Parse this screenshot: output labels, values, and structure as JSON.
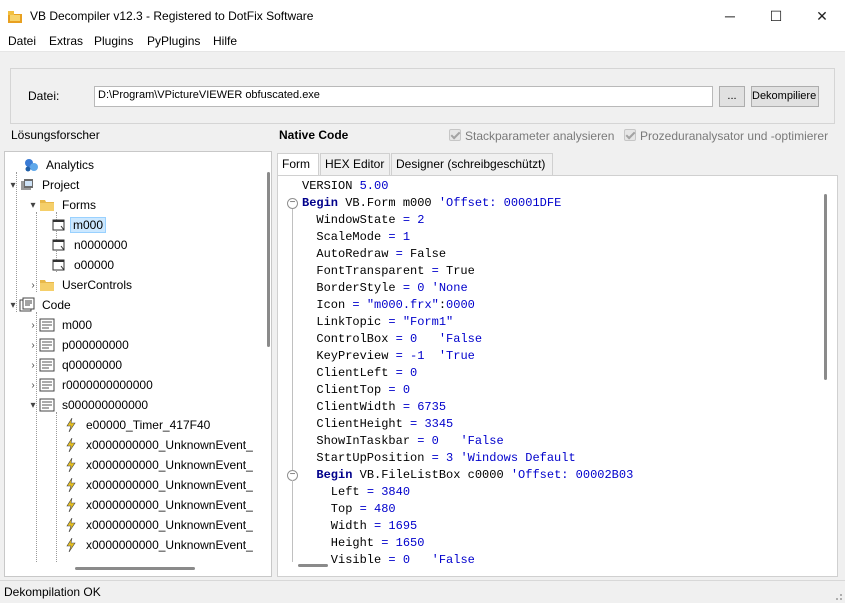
{
  "window": {
    "title": "VB Decompiler v12.3 - Registered to DotFix Software",
    "minimize_glyph": "─",
    "maximize_glyph": "☐",
    "close_glyph": "✕"
  },
  "menu": [
    "Datei",
    "Extras",
    "Plugins",
    "PyPlugins",
    "Hilfe"
  ],
  "file_panel": {
    "label": "Datei:",
    "path": "D:\\Program\\VPictureVIEWER obfuscated.exe",
    "browse_label": "...",
    "decompile_label": "Dekompiliere"
  },
  "headings": {
    "solution_explorer": "Lösungsforscher",
    "native_code": "Native Code"
  },
  "options": {
    "stack_params": {
      "label": "Stackparameter analysieren",
      "checked": true,
      "enabled": false
    },
    "proc_analyzer": {
      "label": "Prozeduranalysator und -optimierer",
      "checked": true,
      "enabled": false
    }
  },
  "tree": [
    {
      "label": "Analytics",
      "icon": "analytics-icon",
      "expander": "",
      "selected": false
    },
    {
      "label": "Project",
      "icon": "project-icon",
      "expander": "▾",
      "selected": false
    },
    {
      "label": "Forms",
      "icon": "folder-open-icon",
      "expander": "▾",
      "selected": false
    },
    {
      "label": "m000",
      "icon": "form-icon",
      "expander": "",
      "selected": true
    },
    {
      "label": "n0000000",
      "icon": "form-icon",
      "expander": "",
      "selected": false
    },
    {
      "label": "o00000",
      "icon": "form-icon",
      "expander": "",
      "selected": false
    },
    {
      "label": "UserControls",
      "icon": "folder-icon",
      "expander": "›",
      "selected": false
    },
    {
      "label": "Code",
      "icon": "code-icon",
      "expander": "▾",
      "selected": false
    },
    {
      "label": "m000",
      "icon": "module-icon",
      "expander": "›",
      "selected": false
    },
    {
      "label": "p000000000",
      "icon": "module-icon",
      "expander": "›",
      "selected": false
    },
    {
      "label": "q00000000",
      "icon": "module-icon",
      "expander": "›",
      "selected": false
    },
    {
      "label": "r0000000000000",
      "icon": "module-icon",
      "expander": "›",
      "selected": false
    },
    {
      "label": "s000000000000",
      "icon": "module-icon",
      "expander": "▾",
      "selected": false
    },
    {
      "label": "e00000_Timer_417F40",
      "icon": "event-icon",
      "expander": "",
      "selected": false
    },
    {
      "label": "x0000000000_UnknownEvent_",
      "icon": "event-icon",
      "expander": "",
      "selected": false
    },
    {
      "label": "x0000000000_UnknownEvent_",
      "icon": "event-icon",
      "expander": "",
      "selected": false
    },
    {
      "label": "x0000000000_UnknownEvent_",
      "icon": "event-icon",
      "expander": "",
      "selected": false
    },
    {
      "label": "x0000000000_UnknownEvent_",
      "icon": "event-icon",
      "expander": "",
      "selected": false
    },
    {
      "label": "x0000000000_UnknownEvent_",
      "icon": "event-icon",
      "expander": "",
      "selected": false
    },
    {
      "label": "x0000000000_UnknownEvent_",
      "icon": "event-icon",
      "expander": "",
      "selected": false
    }
  ],
  "tabs": [
    {
      "label": "Form",
      "active": true
    },
    {
      "label": "HEX Editor",
      "active": false
    },
    {
      "label": "Designer (schreibgeschützt)",
      "active": false
    }
  ],
  "code_lines": [
    "VERSION 5.00",
    "Begin VB.Form m000 'Offset: 00001DFE",
    "  WindowState = 2",
    "  ScaleMode = 1",
    "  AutoRedraw = False",
    "  FontTransparent = True",
    "  BorderStyle = 0 'None",
    "  Icon = \"m000.frx\":0000",
    "  LinkTopic = \"Form1\"",
    "  ControlBox = 0   'False",
    "  KeyPreview = -1  'True",
    "  ClientLeft = 0",
    "  ClientTop = 0",
    "  ClientWidth = 6735",
    "  ClientHeight = 3345",
    "  ShowInTaskbar = 0   'False",
    "  StartUpPosition = 3 'Windows Default",
    "  Begin VB.FileListBox c0000 'Offset: 00002B03",
    "    Left = 3840",
    "    Top = 480",
    "    Width = 1695",
    "    Height = 1650",
    "    Visible = 0   'False"
  ],
  "status": "Dekompilation OK"
}
